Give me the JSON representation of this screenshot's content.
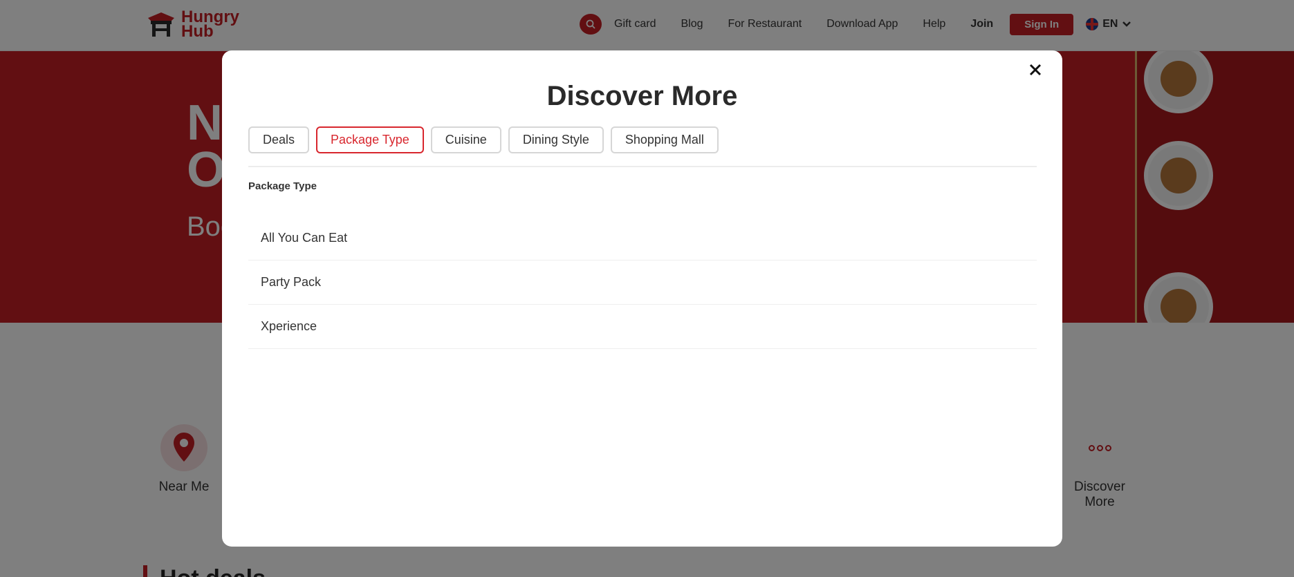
{
  "header": {
    "logo_line1": "Hungry",
    "logo_line2": "Hub",
    "nav": [
      {
        "label": "Gift card"
      },
      {
        "label": "Blog"
      },
      {
        "label": "For Restaurant"
      },
      {
        "label": "Download App"
      },
      {
        "label": "Help"
      },
      {
        "label": "Join"
      }
    ],
    "signin_label": "Sign In",
    "language": "EN"
  },
  "hero": {
    "title_line1": "N",
    "title_line2": "O",
    "subtitle": "Boo"
  },
  "categories": [
    {
      "label": "Near Me",
      "icon": "map-pin-icon"
    },
    {
      "label": "Discover More",
      "icon": "more-dots-icon"
    }
  ],
  "section_heading": "Hot deals",
  "modal": {
    "title": "Discover More",
    "tabs": [
      {
        "label": "Deals",
        "active": false
      },
      {
        "label": "Package Type",
        "active": true
      },
      {
        "label": "Cuisine",
        "active": false
      },
      {
        "label": "Dining Style",
        "active": false
      },
      {
        "label": "Shopping Mall",
        "active": false
      }
    ],
    "section_label": "Package Type",
    "options": [
      {
        "label": "All You Can Eat"
      },
      {
        "label": "Party Pack"
      },
      {
        "label": "Xperience"
      }
    ]
  },
  "colors": {
    "brand": "#c41e24",
    "active_tab": "#d8262d",
    "overlay": "rgba(0,0,0,0.5)"
  }
}
